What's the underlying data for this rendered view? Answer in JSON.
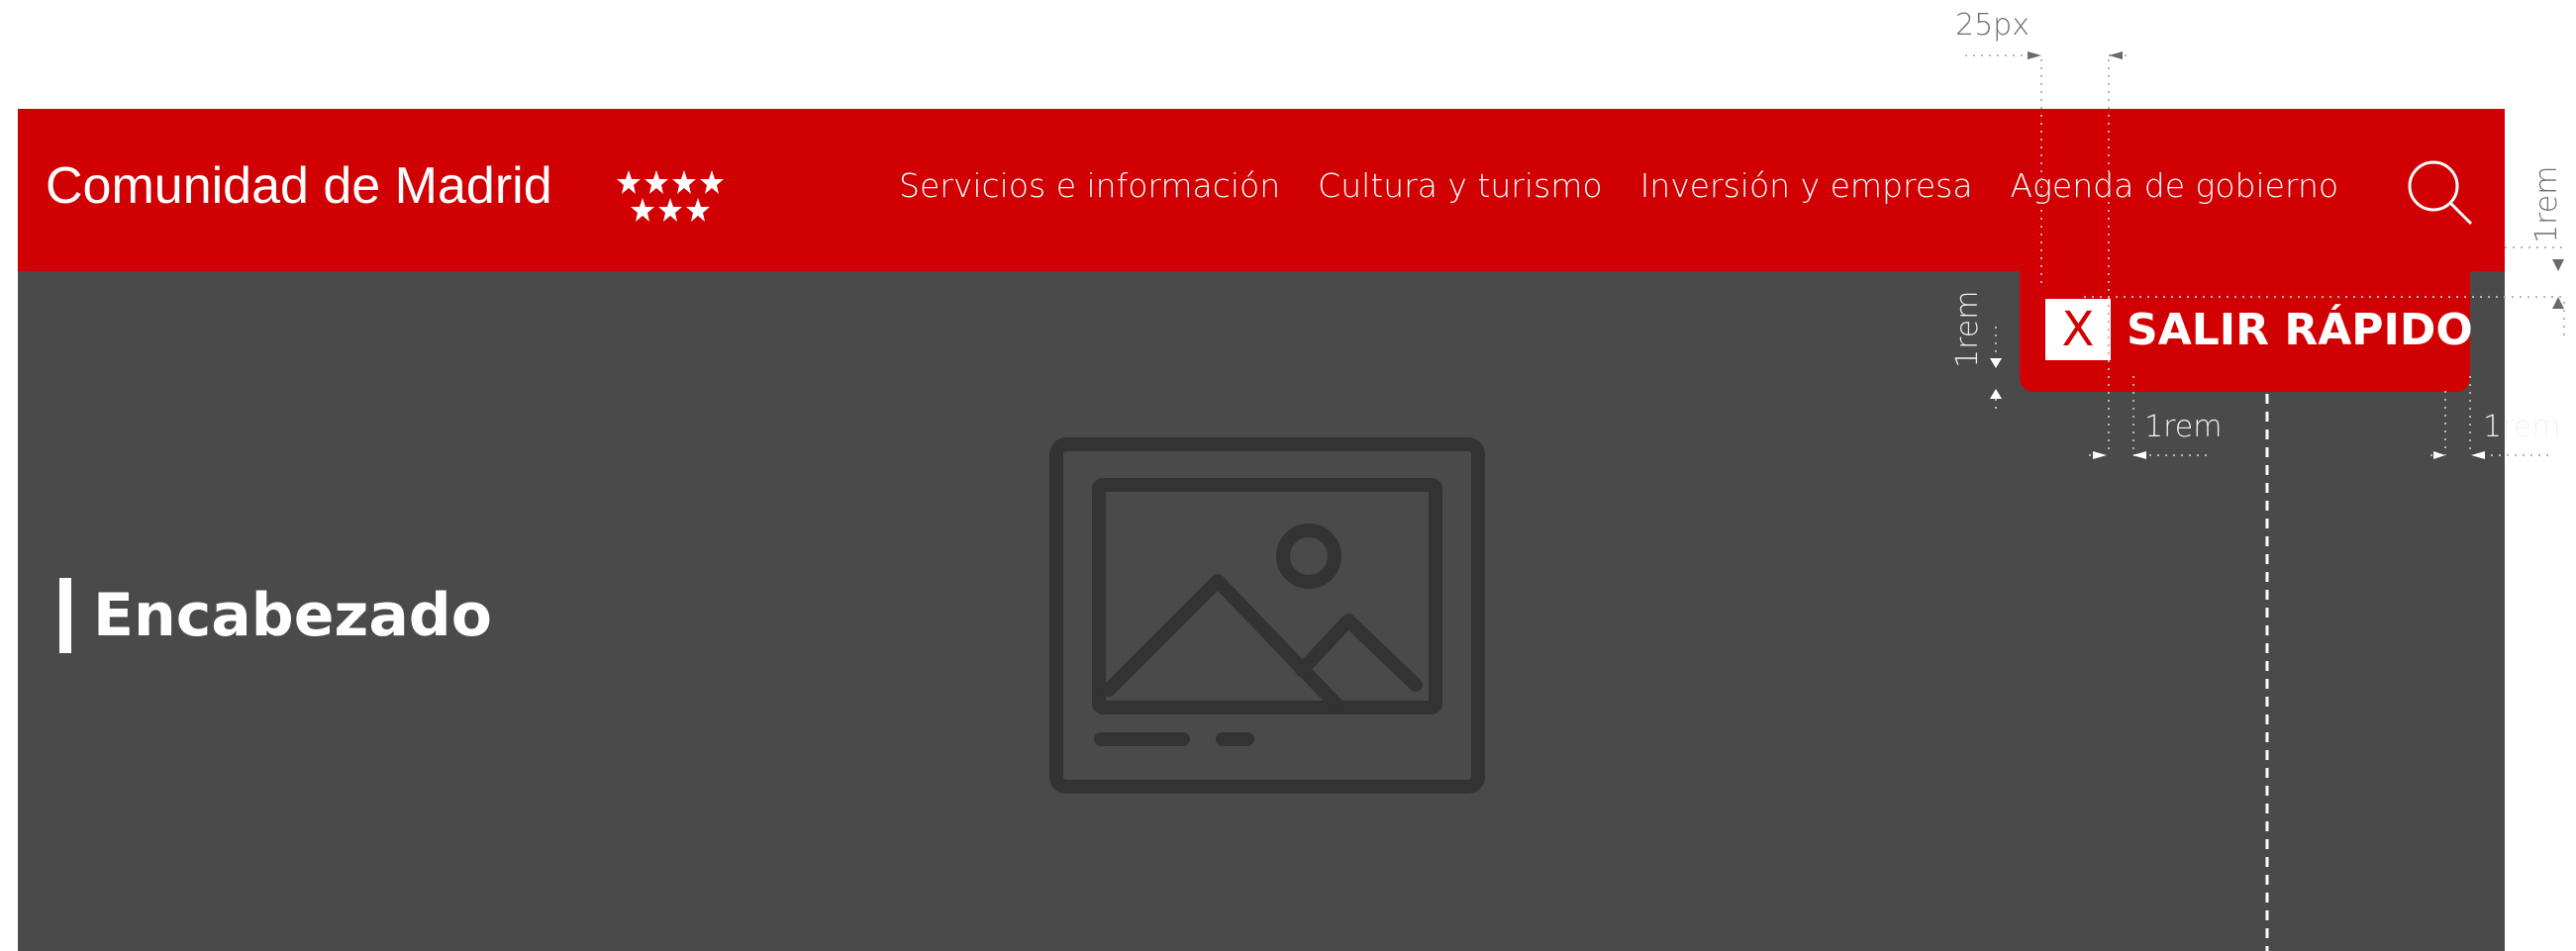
{
  "header": {
    "logo_text": "Comunidad de Madrid",
    "nav": [
      "Servicios e información",
      "Cultura y turismo",
      "Inversión y empresa",
      "Agenda de gobierno"
    ],
    "search_icon": "search-icon",
    "background": "#d10003"
  },
  "hero": {
    "heading": "Encabezado",
    "placeholder_icon": "image-placeholder-icon",
    "background": "#4a4a4a"
  },
  "exit_button": {
    "icon_glyph": "X",
    "label": "SALIR RÁPIDO"
  },
  "annotations": {
    "top_gap": "25px",
    "right_offset": "1rem",
    "left_offset": "1rem",
    "inner_padding_left": "1rem",
    "inner_padding_right": "1rem"
  }
}
